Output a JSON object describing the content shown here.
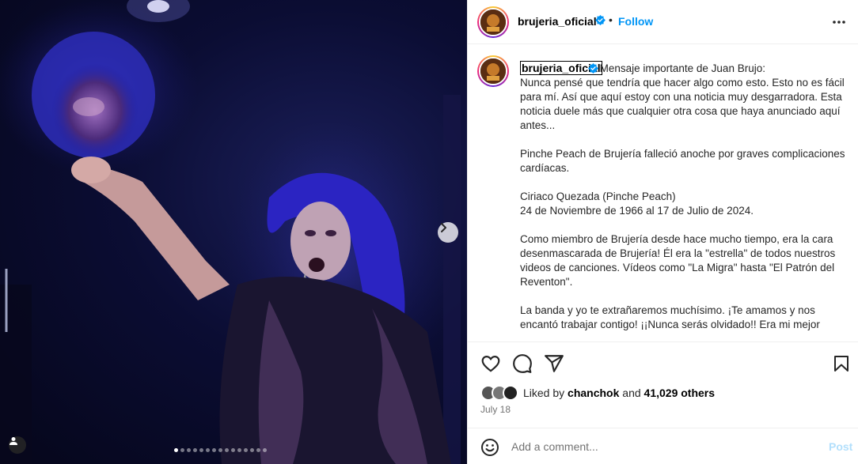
{
  "post": {
    "username": "brujeria_oficial",
    "verified": true,
    "follow_label": "Follow",
    "separator": "•",
    "caption_lead": "Mensaje importante de Juan Brujo:",
    "caption_body": "\nNunca pensé que tendría que hacer algo como esto. Esto no es fácil para mí. Así que aquí estoy con una noticia muy desgarradora. Esta noticia duele más que cualquier otra cosa que haya anunciado aquí antes...\n\nPinche Peach de Brujería falleció anoche por graves complicaciones cardíacas.\n\nCiriaco Quezada (Pinche Peach)\n24 de Noviembre de 1966 al 17 de Julio de 2024.\n\nComo miembro de Brujería desde hace mucho tiempo, era la cara desenmascarada de Brujería! Él era la \"estrella\" de todos nuestros videos de canciones. Vídeos como \"La Migra\" hasta \"El Patrón del Reventon\".\n\nLa banda y yo te extrañaremos muchísimo. ¡Te amamos y nos encantó trabajar contigo! ¡¡Nunca serás olvidado!! Era mi mejor",
    "likes": {
      "prefix": "Liked by",
      "user": "chanchok",
      "and": "and",
      "count": "41,029 others"
    },
    "date": "July 18"
  },
  "comment": {
    "placeholder": "Add a comment...",
    "post_label": "Post"
  },
  "carousel": {
    "total_slides": 15,
    "active_slide": 1
  },
  "icons": {
    "header": [
      "verified-badge-icon",
      "more-options-icon"
    ],
    "media": [
      "next-arrow-icon",
      "user-tag-icon"
    ],
    "actions": [
      "heart-icon",
      "comment-icon",
      "share-icon",
      "bookmark-icon",
      "emoji-icon"
    ]
  },
  "colors": {
    "accent": "#0095f6",
    "verified": "#0095f6",
    "post_disabled": "#b2dffc",
    "stage_light": "#2b2bd4"
  }
}
